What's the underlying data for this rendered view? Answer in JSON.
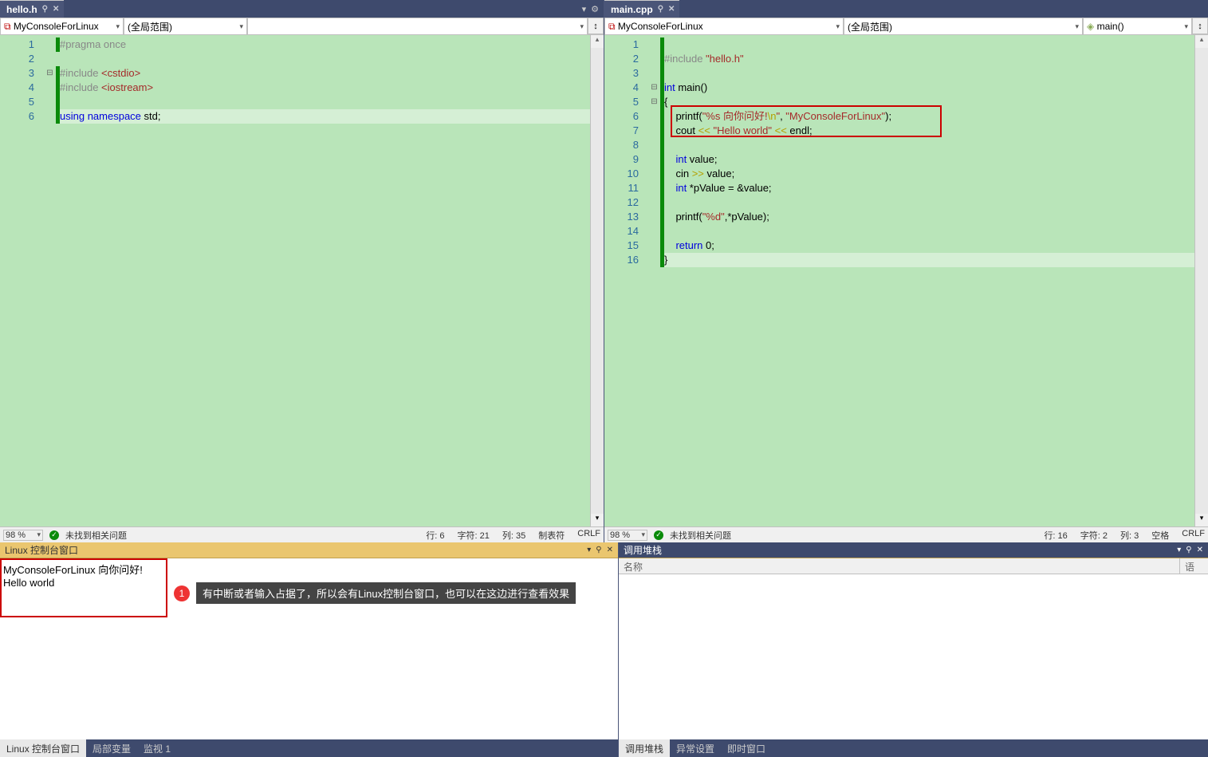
{
  "left_editor": {
    "tab": {
      "name": "hello.h"
    },
    "nav": {
      "project": "MyConsoleForLinux",
      "scope": "(全局范围)",
      "member": ""
    },
    "lines": [
      "1",
      "2",
      "3",
      "4",
      "5",
      "6"
    ],
    "code_tokens": {
      "l1_pp": "#pragma once",
      "l3_pp": "#include ",
      "l3_inc": "<cstdio>",
      "l4_pp": "#include ",
      "l4_inc": "<iostream>",
      "l6_kw1": "using",
      "l6_kw2": "namespace",
      "l6_id": " std;"
    },
    "status": {
      "zoom": "98 %",
      "issues": "未找到相关问题",
      "line": "行: 6",
      "char": "字符: 21",
      "col": "列: 35",
      "tab": "制表符",
      "eol": "CRLF"
    }
  },
  "right_editor": {
    "tab": {
      "name": "main.cpp"
    },
    "nav": {
      "project": "MyConsoleForLinux",
      "scope": "(全局范围)",
      "member": "main()"
    },
    "lines": [
      "1",
      "2",
      "3",
      "4",
      "5",
      "6",
      "7",
      "8",
      "9",
      "10",
      "11",
      "12",
      "13",
      "14",
      "15",
      "16"
    ],
    "code": {
      "l2_pp": "#include ",
      "l2_inc": "\"hello.h\"",
      "l4_kw": "int",
      "l4_fn": " main()",
      "l5": "{",
      "l6_a": "    printf(",
      "l6_b": "\"%s 向你问好!",
      "l6_c": "\\n",
      "l6_d": "\"",
      "l6_e": ", ",
      "l6_f": "\"MyConsoleForLinux\"",
      "l6_g": ");",
      "l7_a": "    cout ",
      "l7_b": "<<",
      "l7_c": " ",
      "l7_d": "\"Hello world\"",
      "l7_e": " ",
      "l7_f": "<<",
      "l7_g": " endl;",
      "l9_kw": "int",
      "l9_r": " value;",
      "l10_a": "    cin ",
      "l10_b": ">>",
      "l10_c": " value;",
      "l11_kw": "int",
      "l11_r": " *pValue = &value;",
      "l13_a": "    printf(",
      "l13_b": "\"%d\"",
      "l13_c": ",*pValue);",
      "l15_kw": "return",
      "l15_r": " 0;",
      "l16": "}"
    },
    "status": {
      "zoom": "98 %",
      "issues": "未找到相关问题",
      "line": "行: 16",
      "char": "字符: 2",
      "col": "列: 3",
      "tab": "空格",
      "eol": "CRLF"
    }
  },
  "console": {
    "title": "Linux 控制台窗口",
    "line1": "MyConsoleForLinux 向你问好!",
    "line2": "Hello world",
    "annotation_num": "1",
    "annotation_text": "有中断或者输入占据了，所以会有Linux控制台窗口，也可以在这边进行查看效果"
  },
  "callstack": {
    "title": "调用堆栈",
    "col_name": "名称",
    "col_lang": "语言"
  },
  "bottom_tabs_left": [
    "Linux 控制台窗口",
    "局部变量",
    "监视 1"
  ],
  "bottom_tabs_right": [
    "调用堆栈",
    "异常设置",
    "即时窗口"
  ]
}
